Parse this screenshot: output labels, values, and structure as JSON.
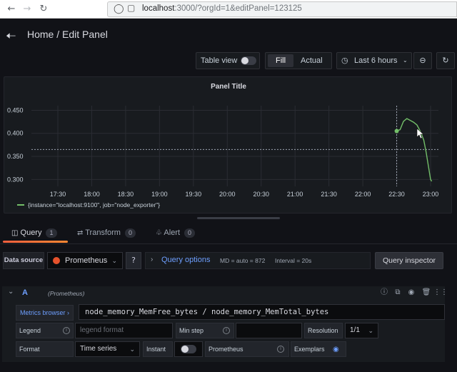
{
  "browser": {
    "url_host": "localhost",
    "url_rest": ":3000/?orgId=1&editPanel=123125"
  },
  "header": {
    "breadcrumb": "Home / Edit Panel"
  },
  "toolbar": {
    "table_view_label": "Table view",
    "table_view_on": false,
    "fill_label": "Fill",
    "actual_label": "Actual",
    "time_range_label": "Last 6 hours"
  },
  "panel": {
    "title": "Panel Title"
  },
  "chart_data": {
    "type": "line",
    "title": "Panel Title",
    "x_ticks": [
      "17:30",
      "18:00",
      "18:30",
      "19:00",
      "19:30",
      "20:00",
      "20:30",
      "21:00",
      "21:30",
      "22:00",
      "22:30",
      "23:00"
    ],
    "y_ticks": [
      "0.300",
      "0.350",
      "0.400",
      "0.450"
    ],
    "ylim": [
      0.285,
      0.46
    ],
    "grid": true,
    "legend_placement": "bottom-left",
    "series": [
      {
        "name": "{instance=\"localhost:9100\", job=\"node_exporter\"}",
        "color": "#73bf69",
        "points": [
          [
            "22:30",
            0.405
          ],
          [
            "22:33",
            0.408
          ],
          [
            "22:36",
            0.426
          ],
          [
            "22:39",
            0.432
          ],
          [
            "22:42",
            0.428
          ],
          [
            "22:45",
            0.424
          ],
          [
            "22:48",
            0.418
          ],
          [
            "22:51",
            0.404
          ],
          [
            "22:54",
            0.385
          ],
          [
            "22:56",
            0.36
          ],
          [
            "22:58",
            0.33
          ],
          [
            "23:00",
            0.3
          ],
          [
            "23:01",
            0.296
          ]
        ]
      }
    ],
    "crosshair": {
      "x": "22:30",
      "y": 0.365
    }
  },
  "tabs": [
    {
      "label": "Query",
      "count": "1",
      "active": true
    },
    {
      "label": "Transform",
      "count": "0",
      "active": false
    },
    {
      "label": "Alert",
      "count": "0",
      "active": false
    }
  ],
  "query": {
    "datasource_label": "Data source",
    "datasource_value": "Prometheus",
    "options_label": "Query options",
    "md_text": "MD = auto = 872",
    "interval_text": "Interval = 20s",
    "inspector_label": "Query inspector",
    "row_letter": "A",
    "row_datasource": "(Prometheus)",
    "metrics_browser_label": "Metrics browser",
    "expression": "node_memory_MemFree_bytes / node_memory_MemTotal_bytes",
    "legend_label": "Legend",
    "legend_placeholder": "legend format",
    "min_step_label": "Min step",
    "min_step_value": "",
    "resolution_label": "Resolution",
    "resolution_value": "1/1",
    "format_label": "Format",
    "format_value": "Time series",
    "instant_label": "Instant",
    "prometheus_label": "Prometheus",
    "exemplars_label": "Exemplars"
  }
}
